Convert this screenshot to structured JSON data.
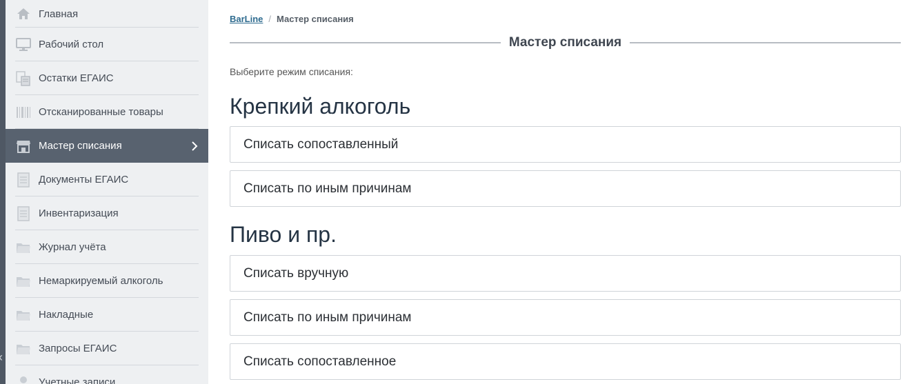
{
  "sidebar": {
    "items": [
      {
        "label": "Главная",
        "icon": "home-icon"
      },
      {
        "label": "Рабочий стол",
        "icon": "monitor-icon"
      },
      {
        "label": "Остатки ЕГАИС",
        "icon": "stock-icon"
      },
      {
        "label": "Отсканированные товары",
        "icon": "barcode-icon"
      },
      {
        "label": "Мастер списания",
        "icon": "store-icon",
        "active": true
      },
      {
        "label": "Документы ЕГАИС",
        "icon": "document-icon"
      },
      {
        "label": "Инвентаризация",
        "icon": "document-icon"
      },
      {
        "label": "Журнал учёта",
        "icon": "folder-icon"
      },
      {
        "label": "Немаркируемый алкоголь",
        "icon": "folder-icon"
      },
      {
        "label": "Накладные",
        "icon": "folder-icon"
      },
      {
        "label": "Запросы ЕГАИС",
        "icon": "folder-icon"
      },
      {
        "label": "Учетные записи",
        "icon": "user-icon"
      }
    ]
  },
  "breadcrumb": {
    "root": "BarLine",
    "current": "Мастер списания"
  },
  "page": {
    "title": "Мастер списания",
    "subtitle": "Выберите режим списания:"
  },
  "sections": {
    "strong": {
      "heading": "Крепкий алкоголь",
      "options": [
        "Списать сопоставленный",
        "Списать по иным причинам"
      ]
    },
    "beer": {
      "heading": "Пиво и пр.",
      "options": [
        "Списать вручную",
        "Списать по иным причинам",
        "Списать сопоставленное"
      ]
    }
  },
  "colors": {
    "sidebar_bg": "#eef0f2",
    "sidebar_active": "#58626f",
    "heading": "#253444",
    "link": "#2e6b8f"
  }
}
